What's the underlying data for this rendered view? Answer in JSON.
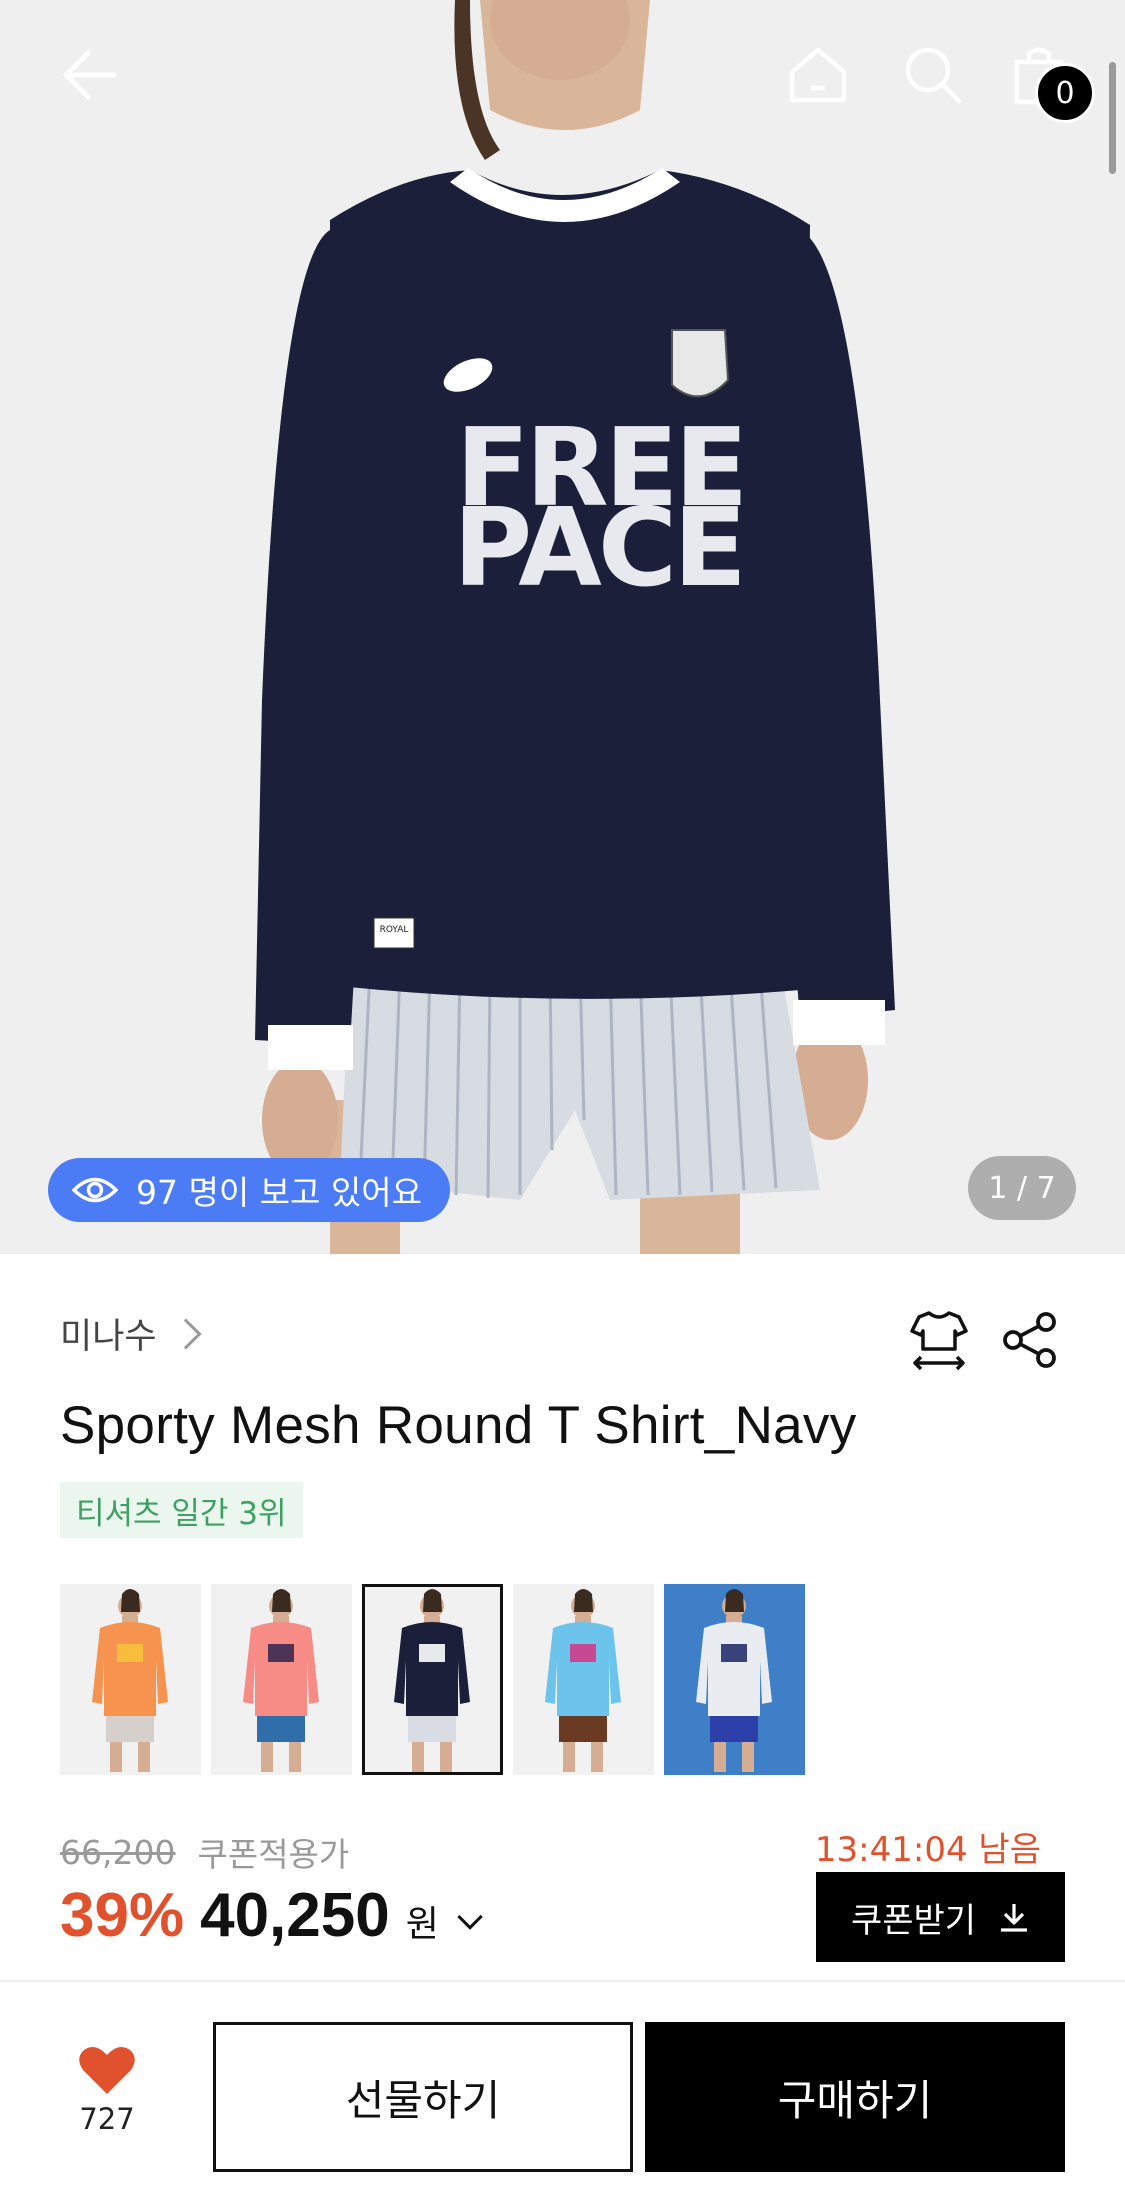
{
  "header": {
    "back_icon": "arrow-left-icon",
    "home_icon": "home-icon",
    "search_icon": "search-icon",
    "cart_icon": "shopping-bag-icon",
    "cart_count": "0"
  },
  "gallery": {
    "viewers_text": "97 명이 보고 있어요",
    "viewers_icon": "eye-icon",
    "page_indicator": "1 / 7",
    "shirt_print_line1": "FREE",
    "shirt_print_line2": "PACE",
    "label_tag": "ROYAL"
  },
  "product": {
    "brand": "미나수",
    "title": "Sporty Mesh Round T Shirt_Navy",
    "rank_badge": "티셔츠 일간 3위",
    "size_icon": "size-guide-shirt-icon",
    "share_icon": "share-icon"
  },
  "color_options": [
    {
      "name": "orange",
      "shirt": "#f6934f",
      "print": "#f7c23b",
      "bottom": "#d5d0cc"
    },
    {
      "name": "pink",
      "shirt": "#f78c86",
      "print": "#3b2a4f",
      "bottom": "#2f6ea8"
    },
    {
      "name": "navy",
      "shirt": "#1b1f3a",
      "print": "#ffffff",
      "bottom": "#d9dde3"
    },
    {
      "name": "sky-blue",
      "shirt": "#6cc3ec",
      "print": "#d33c8a",
      "bottom": "#6b3a22"
    },
    {
      "name": "white",
      "shirt": "#e9ecf0",
      "print": "#26306e",
      "bottom": "#2d3fa8"
    }
  ],
  "pricing": {
    "original_price": "66,200",
    "coupon_label": "쿠폰적용가",
    "timer": "13:41:04 남음",
    "discount": "39%",
    "price": "40,250",
    "currency": "원",
    "coupon_button": "쿠폰받기",
    "coupon_icon": "download-icon"
  },
  "bottom_bar": {
    "like_icon": "heart-icon",
    "like_count": "727",
    "gift_button": "선물하기",
    "buy_button": "구매하기"
  },
  "colors": {
    "accent": "#e0512d",
    "viewer_pill": "#4b7bf5",
    "rank_text": "#3ea063",
    "rank_bg": "#eaf6ee"
  }
}
